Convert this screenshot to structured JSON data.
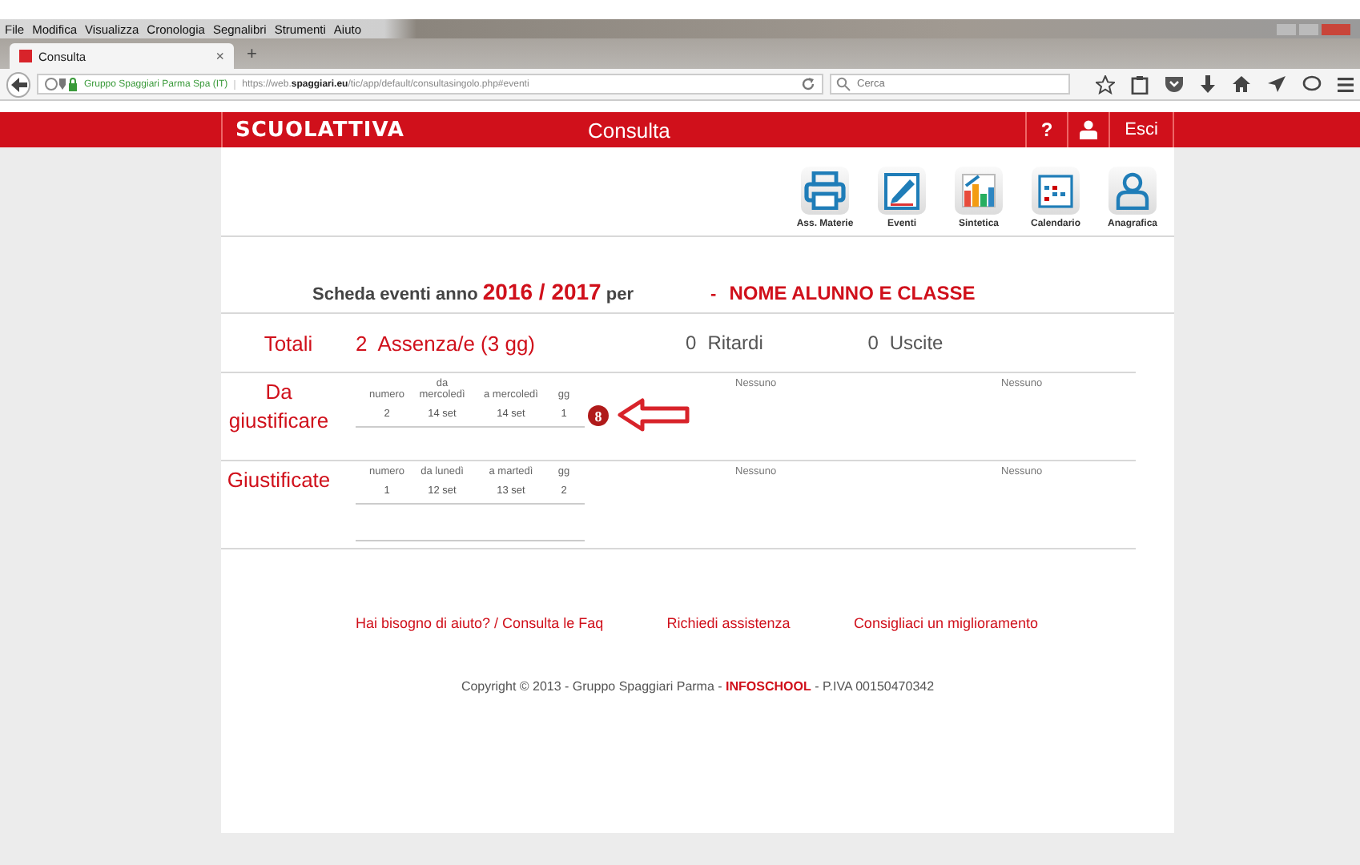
{
  "browser": {
    "menu": [
      "File",
      "Modifica",
      "Visualizza",
      "Cronologia",
      "Segnalibri",
      "Strumenti",
      "Aiuto"
    ],
    "tab": {
      "title": "Consulta",
      "close": "×",
      "selected": true
    },
    "new_tab": "+",
    "address": {
      "site_identity": "Gruppo Spaggiari Parma Spa (IT)",
      "url": "https://web.**spaggiari.eu**/tic/app/default/consultasingolo.php#eventi"
    },
    "search": {
      "placeholder": "Cerca"
    }
  },
  "header": {
    "logo": "SCUOLATTIVA",
    "title": "Consulta",
    "help": "?",
    "logout": "Esci"
  },
  "toolbar": [
    {
      "label": "Ass. Materie",
      "kind": "printer"
    },
    {
      "label": "Eventi",
      "kind": "edit"
    },
    {
      "label": "Sintetica",
      "kind": "chart"
    },
    {
      "label": "Calendario",
      "kind": "calendar"
    },
    {
      "label": "Anagrafica",
      "kind": "person"
    }
  ],
  "heading": {
    "text": "Scheda eventi anno **2016 / 2017** per",
    "dash": "-",
    "student": "NOME ALUNNO E CLASSE"
  },
  "totals": {
    "label": "Totali",
    "absences": "2  Assenza/e (3 gg)",
    "delays_count": "0",
    "delays": "Ritardi",
    "exits_count": "0",
    "exits": "Uscite"
  },
  "sections": [
    {
      "label": "Da giustificare",
      "columns": [
        "numero",
        "da mercoledì",
        "a mercoledì",
        "gg"
      ],
      "rows": [
        [
          "2",
          "14 set",
          "14 set",
          "1"
        ]
      ],
      "badge": "8",
      "arrow": true,
      "delays": "Nessuno",
      "exits": "Nessuno"
    },
    {
      "label": "Giustificate",
      "columns": [
        "numero",
        "da lunedì",
        "a martedì",
        "gg"
      ],
      "rows": [
        [
          "1",
          "12 set",
          "13 set",
          "2"
        ]
      ],
      "delays": "Nessuno",
      "exits": "Nessuno"
    }
  ],
  "footer": {
    "links": [
      "Hai bisogno di aiuto? / Consulta le Faq",
      "Richiedi assistenza",
      "Consigliaci un miglioramento"
    ],
    "copyright": "Copyright © 2013 - Gruppo Spaggiari Parma - **INFOSCHOOL** - P.IVA 00150470342"
  }
}
